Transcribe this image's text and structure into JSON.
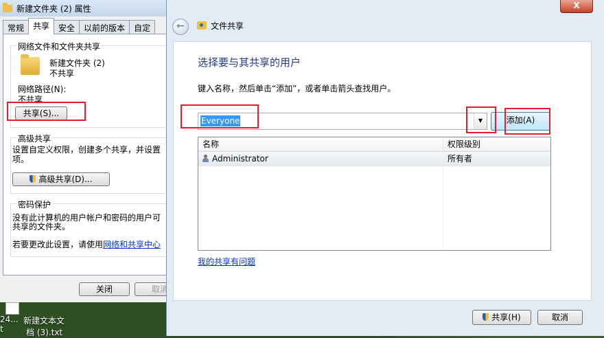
{
  "properties_window": {
    "title": "新建文件夹 (2) 属性",
    "tabs": [
      "常规",
      "共享",
      "安全",
      "以前的版本",
      "自定"
    ],
    "network_group_label": "网络文件和文件夹共享",
    "folder_name": "新建文件夹 (2)",
    "folder_status": "不共享",
    "network_path_label": "网络路径(N):",
    "network_path_value": "不共享",
    "share_button": "共享(S)...",
    "advanced_group_label": "高级共享",
    "advanced_desc_line1": "设置自定义权限，创建多个共享，并设置",
    "advanced_desc_line2": "项。",
    "advanced_button": "高级共享(D)...",
    "password_group_label": "密码保护",
    "password_desc_line1": "没有此计算机的用户帐户和密码的用户可",
    "password_desc_line2": "共享的文件夹。",
    "change_setting_text": "若要更改此设置，请使用",
    "change_setting_link": "网络和共享中心",
    "close_button": "关闭",
    "cancel_button": "取消"
  },
  "desktop": {
    "file_label_line1": "新建文本文",
    "file_label_line2": "档 (3).txt",
    "partial_label_line1": "24...",
    "partial_label_line2": "t"
  },
  "share_dialog": {
    "title": "文件共享",
    "close_glyph": "X",
    "back_glyph": "←",
    "heading": "选择要与其共享的用户",
    "instruction": "键入名称，然后单击“添加”，或者单击箭头查找用户。",
    "input_value": "Everyone",
    "dropdown_glyph": "▼",
    "add_button": "添加(A)",
    "columns": [
      "名称",
      "权限级别"
    ],
    "rows": [
      {
        "name": "Administrator",
        "permission": "所有者"
      }
    ],
    "help_link": "我的共享有问题",
    "share_button": "共享(H)",
    "cancel_button": "取消"
  },
  "colors": {
    "highlight_red": "#e0202a",
    "heading_blue": "#1e3a8a",
    "link_blue": "#0033cc"
  }
}
